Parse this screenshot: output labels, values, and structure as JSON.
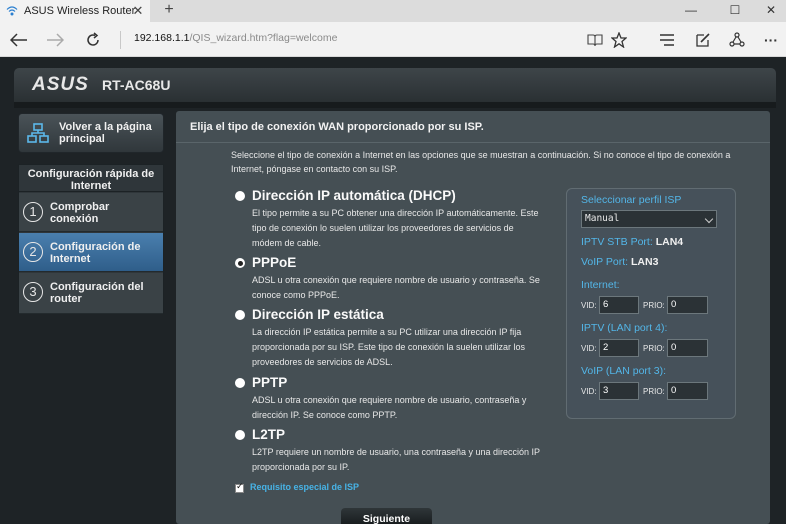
{
  "browser": {
    "tab_title": "ASUS Wireless Router R",
    "tab_close": "✕",
    "new_tab": "+",
    "window_minimize": "—",
    "window_maximize": "☐",
    "window_close": "✕",
    "url_host": "192.168.1.1",
    "url_path": "/QIS_wizard.htm?flag=welcome",
    "more_menu": "···"
  },
  "router": {
    "logo": "ASUS",
    "model": "RT-AC68U"
  },
  "sidebar": {
    "back_label": "Volver a la página principal",
    "quick_setup_title": "Configuración rápida de Internet",
    "steps": [
      {
        "num": "1",
        "label": "Comprobar conexión",
        "active": false
      },
      {
        "num": "2",
        "label": "Configuración de Internet",
        "active": true
      },
      {
        "num": "3",
        "label": "Configuración del router",
        "active": false
      }
    ]
  },
  "main": {
    "title": "Elija el tipo de conexión WAN proporcionado por su ISP.",
    "intro": "Seleccione el tipo de conexión a Internet en las opciones que se muestran a continuación. Si no conoce el tipo de conexión a Internet, póngase en contacto con su ISP.",
    "options": [
      {
        "title": "Dirección IP automática (DHCP)",
        "desc": "El tipo permite a su PC obtener una dirección IP automáticamente. Este tipo de conexión lo suelen utilizar los proveedores de servicios de módem de cable.",
        "checked": false
      },
      {
        "title": "PPPoE",
        "desc": "ADSL u otra conexión que requiere nombre de usuario y contraseña. Se conoce como PPPoE.",
        "checked": true
      },
      {
        "title": "Dirección IP estática",
        "desc": "La dirección IP estática permite a su PC utilizar una dirección IP fija proporcionada por su ISP. Este tipo de conexión la suelen utilizar los proveedores de servicios de ADSL.",
        "checked": false
      },
      {
        "title": "PPTP",
        "desc": "ADSL u otra conexión que requiere nombre de usuario, contraseña y dirección IP. Se conoce como PPTP.",
        "checked": false
      },
      {
        "title": "L2TP",
        "desc": "L2TP requiere un nombre de usuario, una contraseña y una dirección IP proporcionada por su IP.",
        "checked": false
      }
    ],
    "isp_special_label": "Requisito especial de ISP",
    "next_button": "Siguiente"
  },
  "profile": {
    "select_label": "Seleccionar perfil ISP",
    "select_value": "Manual",
    "iptv_stb_label": "IPTV STB Port:",
    "iptv_stb_value": "LAN4",
    "voip_port_label": "VoIP Port:",
    "voip_port_value": "LAN3",
    "vid_label": "VID:",
    "prio_label": "PRIO:",
    "groups": [
      {
        "label": "Internet:",
        "vid": "6",
        "prio": "0"
      },
      {
        "label": "IPTV (LAN port 4):",
        "vid": "2",
        "prio": "0"
      },
      {
        "label": "VoIP (LAN port 3):",
        "vid": "3",
        "prio": "0"
      }
    ]
  }
}
